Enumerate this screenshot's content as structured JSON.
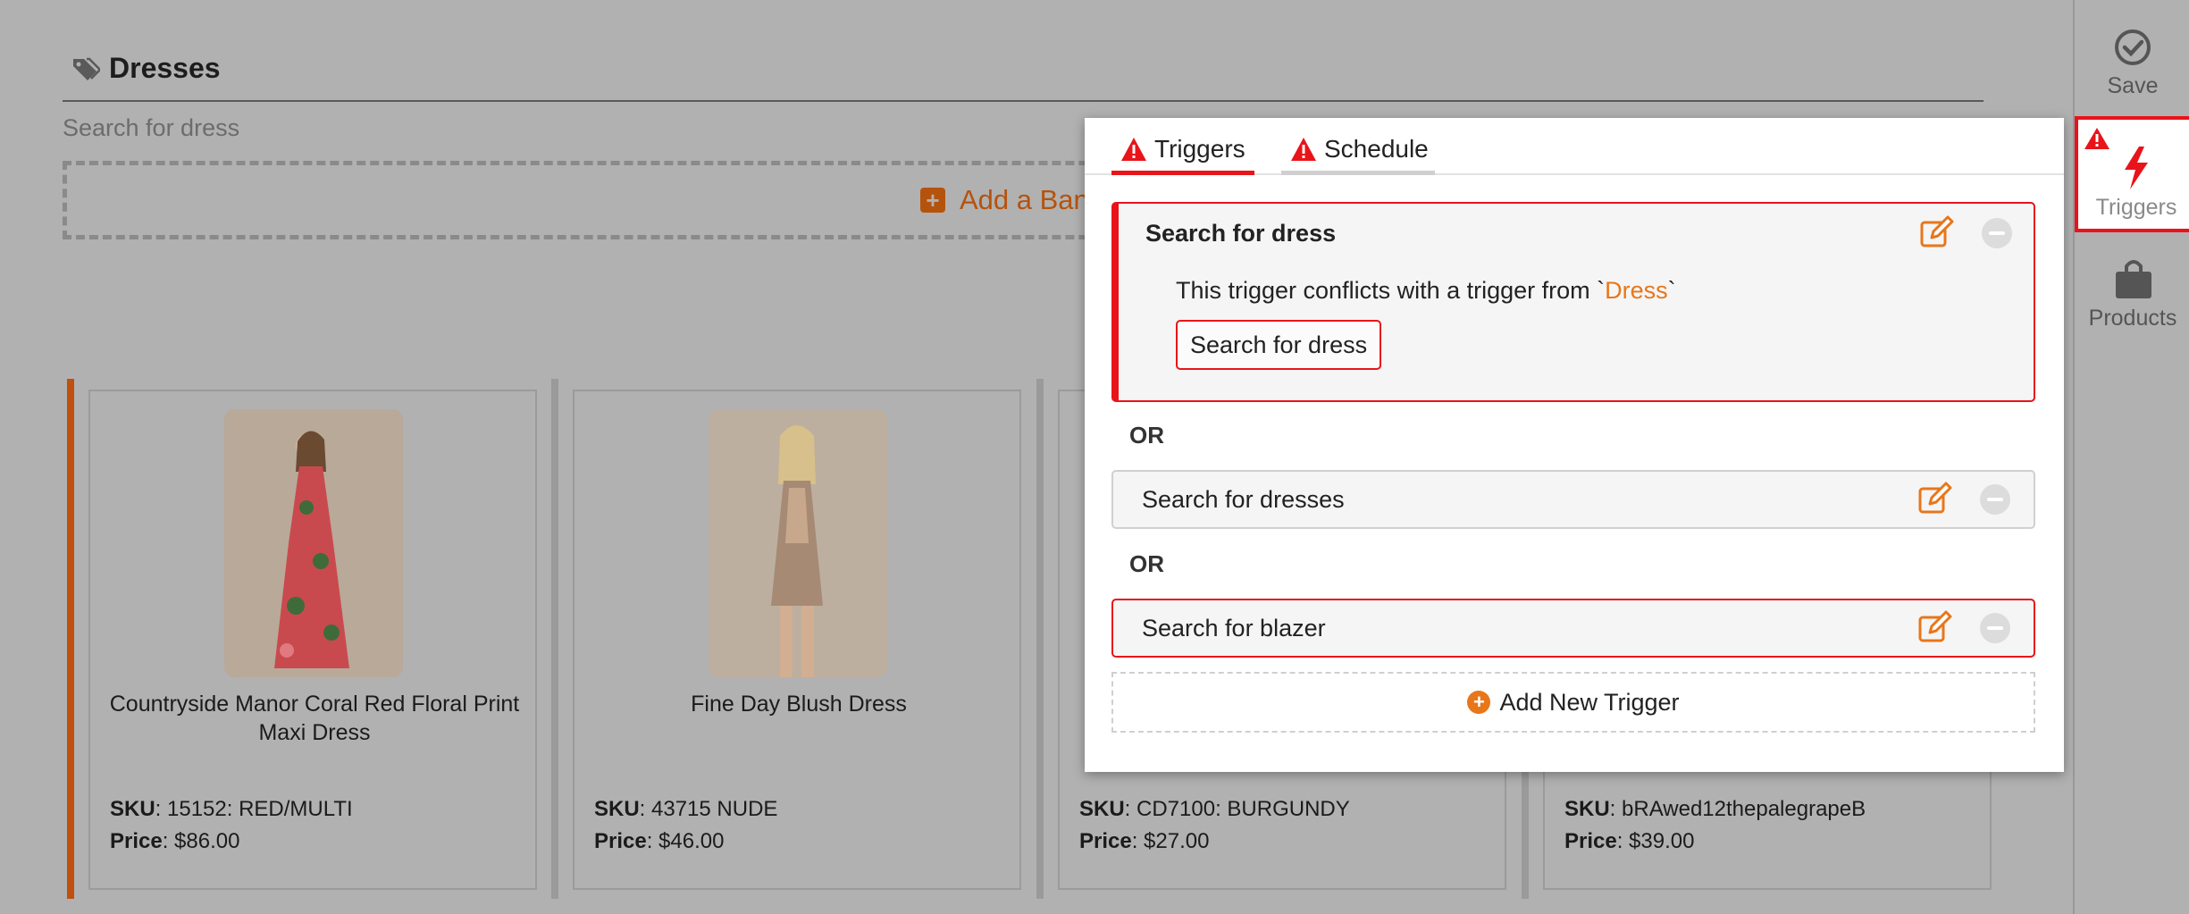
{
  "section": {
    "title": "Dresses",
    "trigger_label": "Search for dress",
    "banner_add_label": "Add a Ban"
  },
  "products": [
    {
      "name": "Countryside Manor Coral Red Floral Print Maxi Dress",
      "sku_label": "SKU",
      "sku": ": 15152: RED/MULTI",
      "price_label": "Price",
      "price": ": $86.00"
    },
    {
      "name": "Fine Day Blush Dress",
      "sku_label": "SKU",
      "sku": ": 43715 NUDE",
      "price_label": "Price",
      "price": ": $46.00"
    },
    {
      "name": "",
      "sku_label": "SKU",
      "sku": ": CD7100: BURGUNDY",
      "price_label": "Price",
      "price": ": $27.00"
    },
    {
      "name": "",
      "sku_label": "SKU",
      "sku": ": bRAwed12thepalegrapeB",
      "price_label": "Price",
      "price": ": $39.00"
    }
  ],
  "rail": {
    "save": "Save",
    "triggers": "Triggers",
    "products": "Products"
  },
  "popup": {
    "tabs": [
      {
        "label": "Triggers",
        "active": true
      },
      {
        "label": "Schedule",
        "active": false
      }
    ],
    "triggers": [
      {
        "title": "Search for dress",
        "conflict_prefix": "This trigger conflicts with a trigger from `",
        "conflict_link": "Dress",
        "conflict_suffix": "`",
        "conflict_chip": "Search for dress"
      },
      {
        "title": "Search for dresses"
      },
      {
        "title": "Search for blazer"
      }
    ],
    "or_label": "OR",
    "add_trigger": "Add New Trigger"
  },
  "colors": {
    "accent": "#e8761a",
    "error": "#e8141a",
    "overlay": "#b1b1b1"
  }
}
